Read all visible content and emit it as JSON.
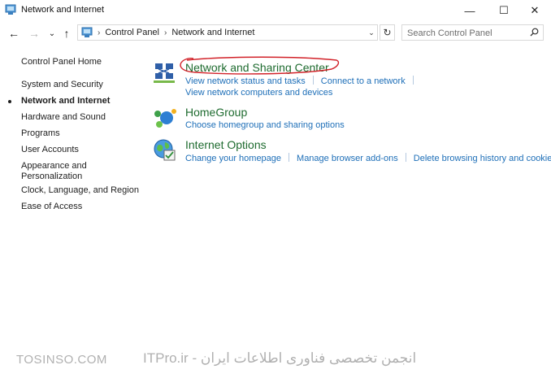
{
  "window": {
    "title": "Network and Internet",
    "minimize": "—",
    "maximize": "☐",
    "close": "✕"
  },
  "nav": {
    "back": "←",
    "forward": "→",
    "recent": "⌄",
    "up": "↑"
  },
  "address": {
    "breadcrumb": [
      "Control Panel",
      "Network and Internet"
    ],
    "separator": "›",
    "dropdown": "⌄",
    "refresh": "↻"
  },
  "search": {
    "placeholder": "Search Control Panel"
  },
  "sidebar": {
    "home": "Control Panel Home",
    "items": [
      {
        "label": "System and Security"
      },
      {
        "label": "Network and Internet",
        "active": true
      },
      {
        "label": "Hardware and Sound"
      },
      {
        "label": "Programs"
      },
      {
        "label": "User Accounts"
      },
      {
        "label": "Appearance and Personalization"
      },
      {
        "label": "Clock, Language, and Region"
      },
      {
        "label": "Ease of Access"
      }
    ]
  },
  "categories": [
    {
      "title": "Network and Sharing Center",
      "icon": "network-sharing-icon",
      "links": [
        "View network status and tasks",
        "Connect to a network",
        "View network computers and devices"
      ],
      "highlighted": true
    },
    {
      "title": "HomeGroup",
      "icon": "homegroup-icon",
      "links": [
        "Choose homegroup and sharing options"
      ]
    },
    {
      "title": "Internet Options",
      "icon": "internet-options-icon",
      "links": [
        "Change your homepage",
        "Manage browser add-ons",
        "Delete browsing history and cookies"
      ]
    }
  ],
  "watermark": {
    "left": "TOSINSO.COM",
    "right": "ITPro.ir - انجمن تخصصی فناوری اطلاعات ایران"
  },
  "colors": {
    "link": "#1e6fb8",
    "category_title": "#1e6b2f",
    "highlight_ring": "#d2232a"
  }
}
